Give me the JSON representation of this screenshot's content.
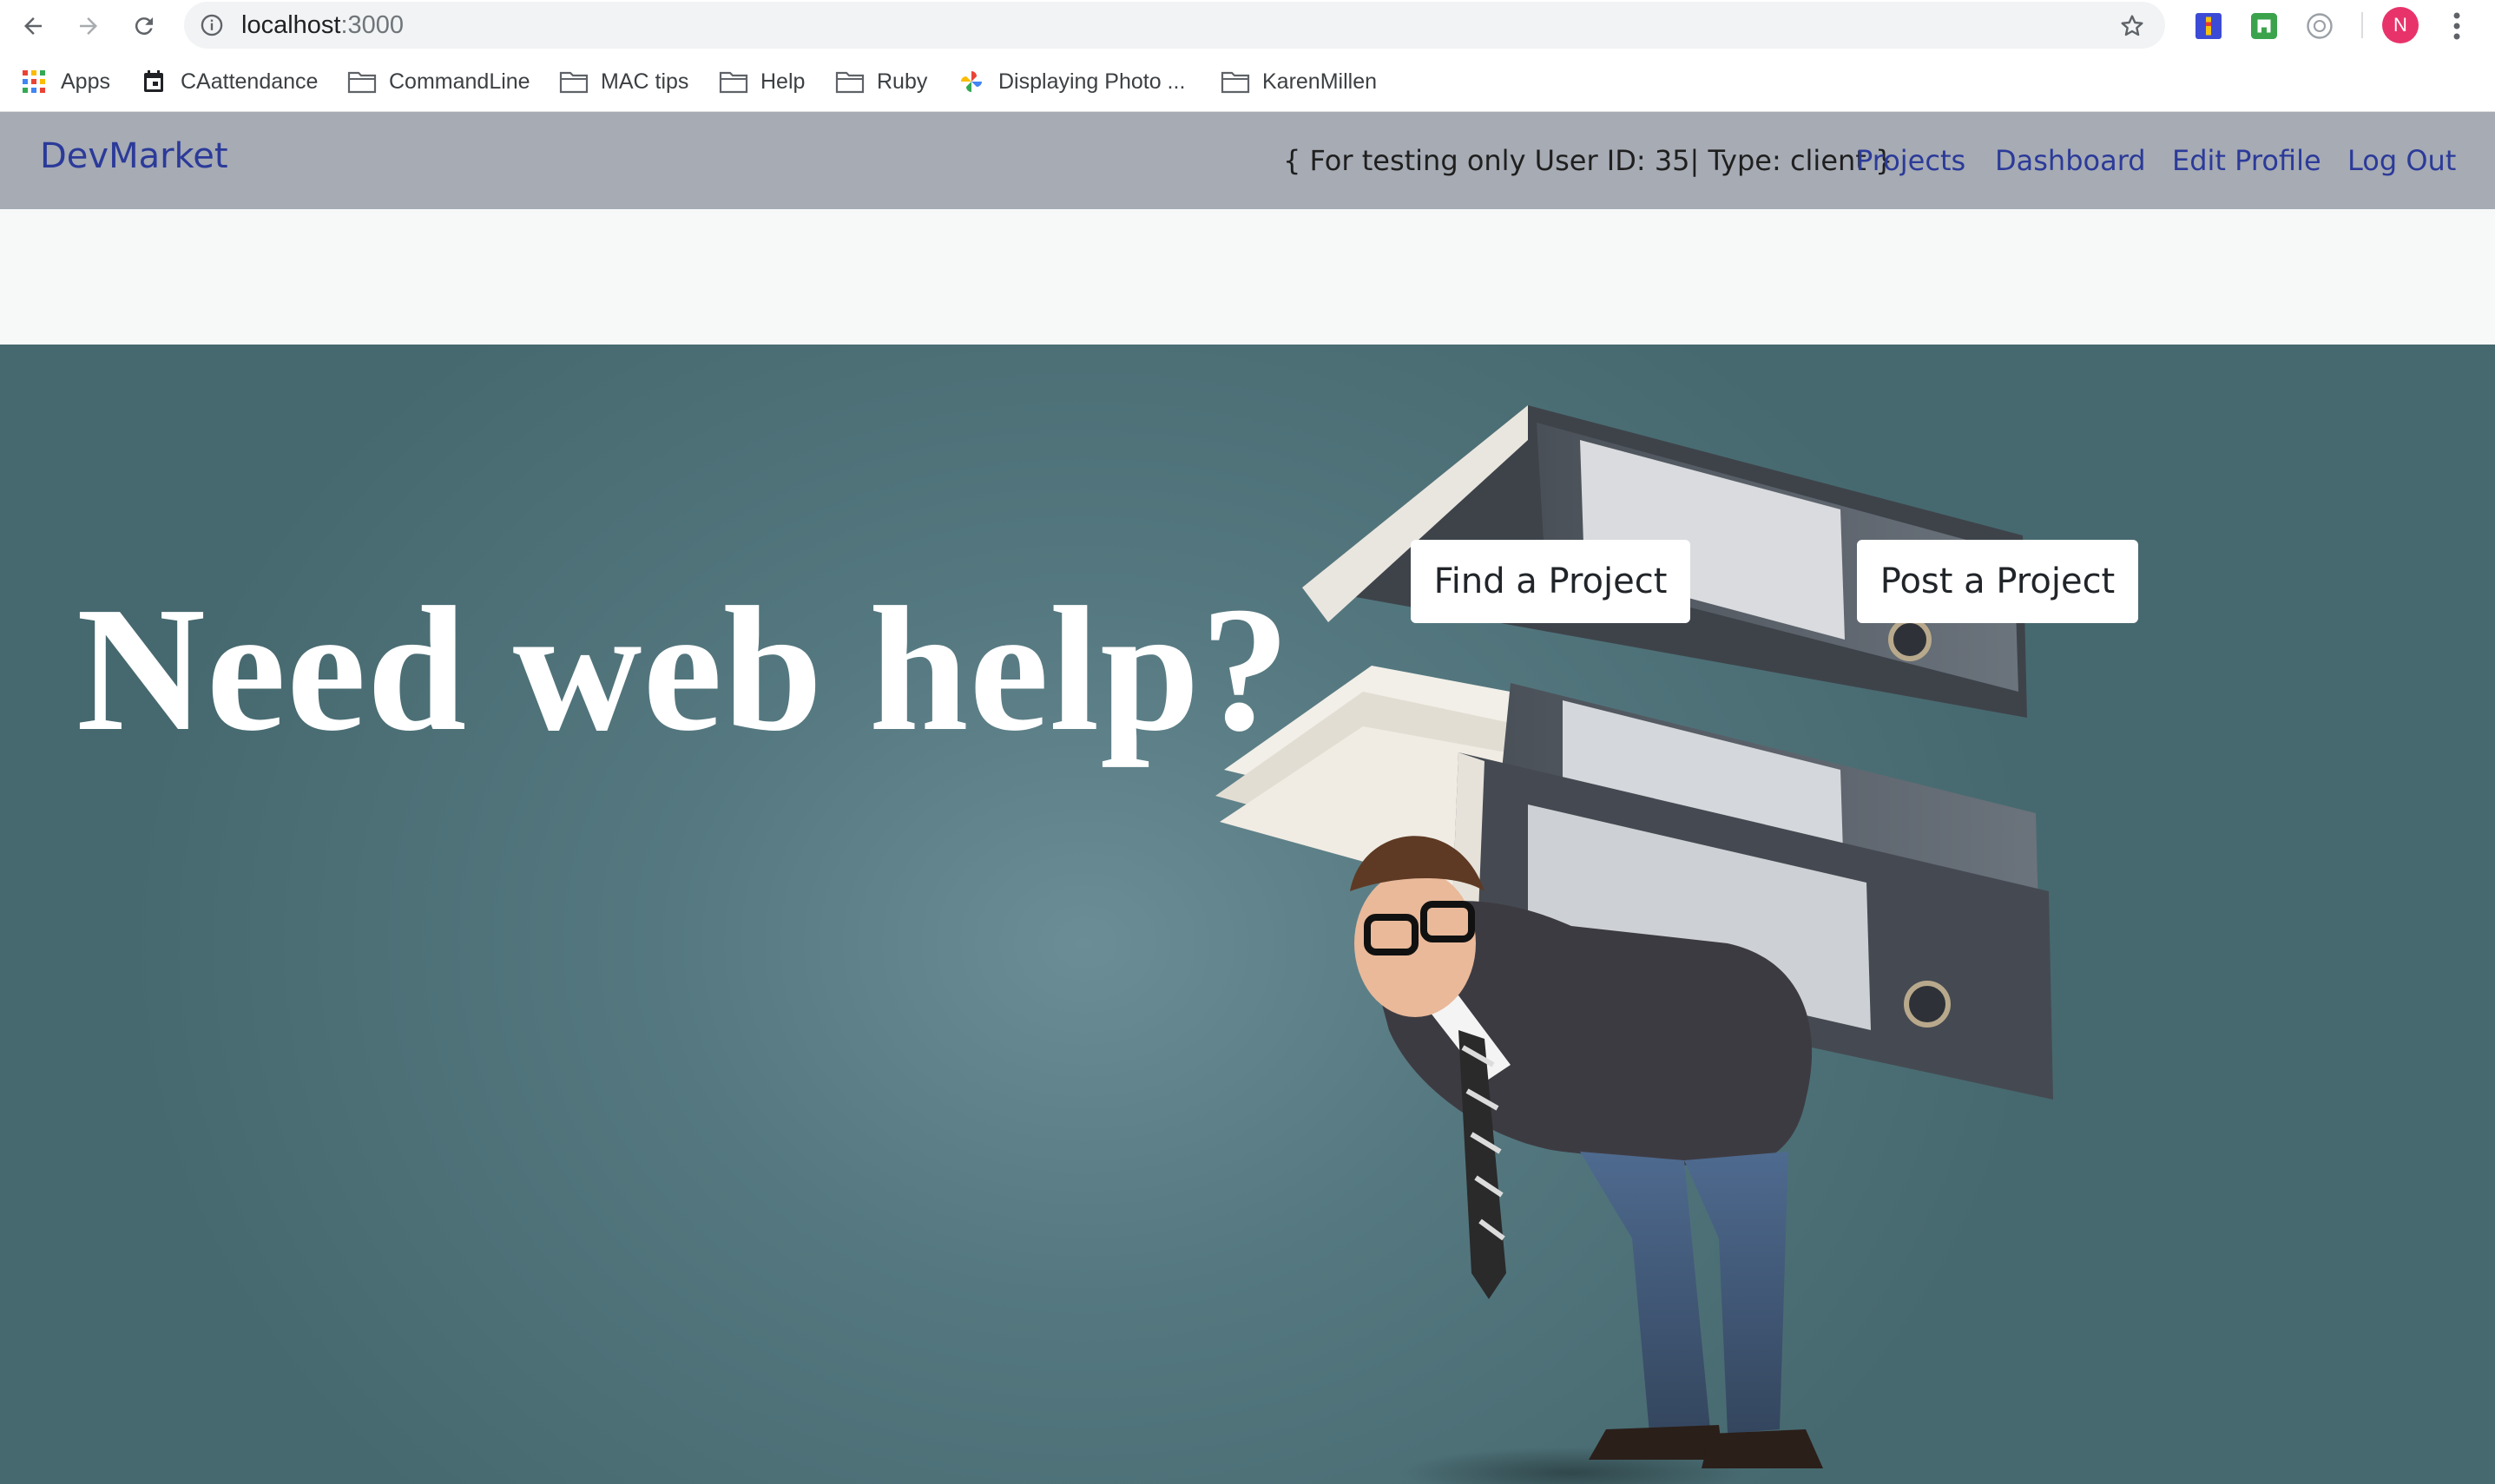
{
  "browser": {
    "url_host": "localhost",
    "url_port": ":3000",
    "profile_initial": "N"
  },
  "bookmarks": [
    {
      "label": "Apps",
      "icon": "apps-grid-icon"
    },
    {
      "label": "CAattendance",
      "icon": "calendar-icon"
    },
    {
      "label": "CommandLine",
      "icon": "folder-icon"
    },
    {
      "label": "MAC tips",
      "icon": "folder-icon"
    },
    {
      "label": "Help",
      "icon": "folder-icon"
    },
    {
      "label": "Ruby",
      "icon": "folder-icon"
    },
    {
      "label": "Displaying Photo ...",
      "icon": "photos-pinwheel-icon"
    },
    {
      "label": "KarenMillen",
      "icon": "folder-icon"
    }
  ],
  "navbar": {
    "brand": "DevMarket",
    "test_info": "{ For testing only User ID: 35| Type: client }",
    "links": [
      "Projects",
      "Dashboard",
      "Edit Profile",
      "Log Out"
    ]
  },
  "hero": {
    "title": "Need web help?",
    "find_button": "Find a Project",
    "post_button": "Post a Project"
  },
  "colors": {
    "navbar_bg": "#a6abb4",
    "link": "#2b3a99",
    "hero_bg": "#557880"
  }
}
